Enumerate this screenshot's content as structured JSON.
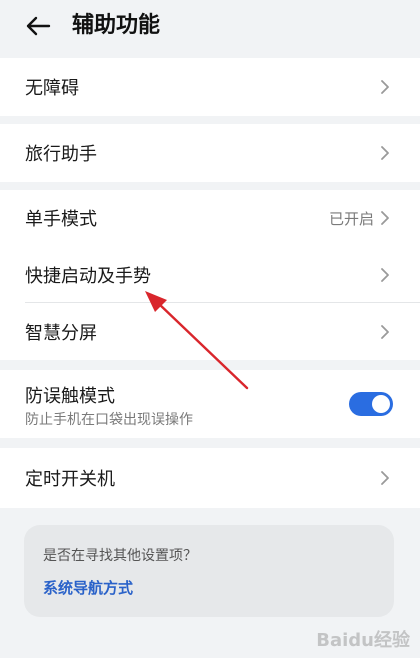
{
  "header": {
    "title": "辅助功能",
    "back_icon": "arrow-left-icon"
  },
  "group1": {
    "label": "无障碍"
  },
  "group2": {
    "label": "旅行助手"
  },
  "group3": {
    "items": [
      {
        "label": "单手模式",
        "value": "已开启"
      },
      {
        "label": "快捷启动及手势",
        "value": ""
      },
      {
        "label": "智慧分屏",
        "value": ""
      }
    ]
  },
  "group4": {
    "title": "防误触模式",
    "subtitle": "防止手机在口袋出现误操作",
    "toggle_on": true
  },
  "group5": {
    "label": "定时开关机"
  },
  "suggest": {
    "question": "是否在寻找其他设置项？",
    "link": "系统导航方式"
  },
  "colors": {
    "accent": "#2a6de1",
    "link": "#2a62c9",
    "annotation_arrow": "#d9262c"
  },
  "watermark": "Baidu经验"
}
